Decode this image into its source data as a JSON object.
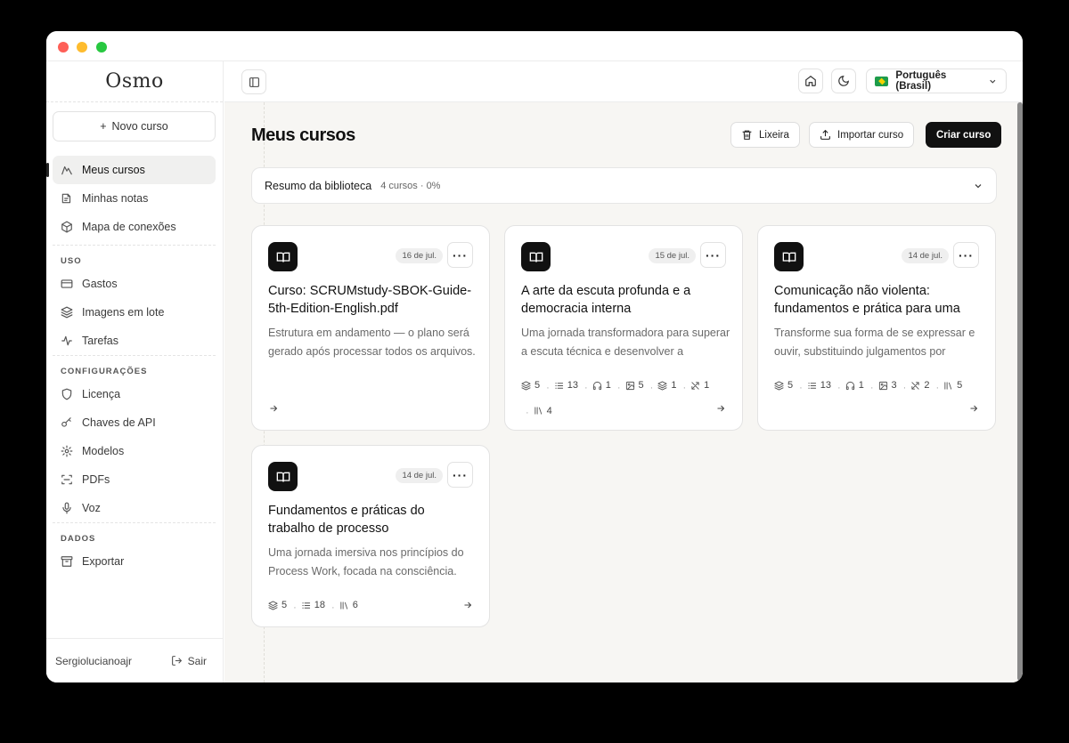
{
  "app": {
    "logo": "Osmo"
  },
  "sidebar": {
    "new_course": "Novo curso",
    "nav": [
      {
        "label": "Meus cursos",
        "icon": "courses-icon",
        "active": true
      },
      {
        "label": "Minhas notas",
        "icon": "notes-icon"
      },
      {
        "label": "Mapa de conexões",
        "icon": "cube-icon"
      }
    ],
    "sections": [
      {
        "title": "USO",
        "items": [
          {
            "label": "Gastos",
            "icon": "card-icon"
          },
          {
            "label": "Imagens em lote",
            "icon": "layers-icon"
          },
          {
            "label": "Tarefas",
            "icon": "activity-icon"
          }
        ]
      },
      {
        "title": "CONFIGURAÇÕES",
        "items": [
          {
            "label": "Licença",
            "icon": "shield-icon"
          },
          {
            "label": "Chaves de API",
            "icon": "key-icon"
          },
          {
            "label": "Modelos",
            "icon": "gear-icon"
          },
          {
            "label": "PDFs",
            "icon": "scan-icon"
          },
          {
            "label": "Voz",
            "icon": "mic-icon"
          }
        ]
      },
      {
        "title": "DADOS",
        "items": [
          {
            "label": "Exportar",
            "icon": "archive-icon"
          }
        ]
      }
    ],
    "user": "Sergiolucianoajr",
    "logout": "Sair"
  },
  "topbar": {
    "language": "Português (Brasil)"
  },
  "page": {
    "title": "Meus cursos",
    "actions": {
      "trash": "Lixeira",
      "import": "Importar curso",
      "create": "Criar curso"
    },
    "summary": {
      "label": "Resumo da biblioteca",
      "meta": "4 cursos · 0%"
    }
  },
  "courses": [
    {
      "date": "16 de jul.",
      "title": "Curso: SCRUMstudy-SBOK-Guide-5th-Edition-English.pdf",
      "desc": "Estrutura em andamento — o plano será gerado após processar todos os arquivos.",
      "stats": []
    },
    {
      "date": "15 de jul.",
      "title": "A arte da escuta profunda e a democracia interna",
      "desc": "Uma jornada transformadora para superar a escuta técnica e desenvolver a presença.",
      "stats": [
        {
          "icon": "layers-icon",
          "value": "5"
        },
        {
          "icon": "list-icon",
          "value": "13"
        },
        {
          "icon": "headphones-icon",
          "value": "1"
        },
        {
          "icon": "image-icon",
          "value": "5"
        },
        {
          "icon": "layers-icon",
          "value": "1"
        },
        {
          "icon": "shuffle-icon",
          "value": "1"
        },
        {
          "icon": "library-icon",
          "value": "4"
        }
      ]
    },
    {
      "date": "14 de jul.",
      "title": "Comunicação não violenta: fundamentos e prática para uma nova linguagem",
      "desc": "Transforme sua forma de se expressar e ouvir, substituindo julgamentos por empatia.",
      "stats": [
        {
          "icon": "layers-icon",
          "value": "5"
        },
        {
          "icon": "list-icon",
          "value": "13"
        },
        {
          "icon": "headphones-icon",
          "value": "1"
        },
        {
          "icon": "image-icon",
          "value": "3"
        },
        {
          "icon": "shuffle-icon",
          "value": "2"
        },
        {
          "icon": "library-icon",
          "value": "5"
        }
      ]
    },
    {
      "date": "14 de jul.",
      "title": "Fundamentos e práticas do trabalho de processo",
      "desc": "Uma jornada imersiva nos princípios do Process Work, focada na consciência.",
      "stats": [
        {
          "icon": "layers-icon",
          "value": "5"
        },
        {
          "icon": "list-icon",
          "value": "18"
        },
        {
          "icon": "library-icon",
          "value": "6"
        }
      ]
    }
  ]
}
